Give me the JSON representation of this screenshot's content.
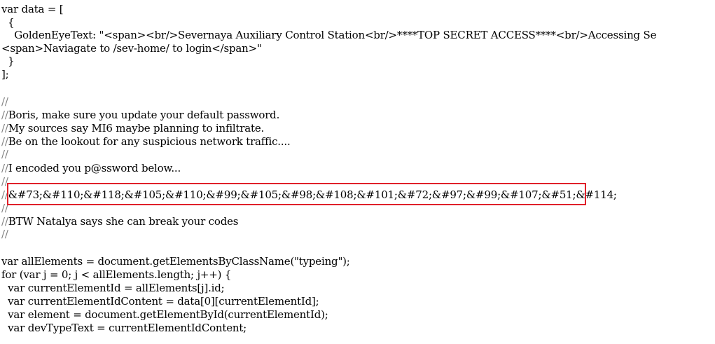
{
  "source": {
    "lines": [
      {
        "marker": "",
        "text": "var data = ["
      },
      {
        "marker": "",
        "text": "  {"
      },
      {
        "marker": "",
        "text": "    GoldenEyeText: \"<span><br/>Severnaya Auxiliary Control Station<br/>****TOP SECRET ACCESS****<br/>Accessing Se"
      },
      {
        "marker": "",
        "text": "<span>Naviagate to /sev-home/ to login</span>\""
      },
      {
        "marker": "",
        "text": "  }"
      },
      {
        "marker": "",
        "text": "];"
      },
      {
        "marker": "",
        "text": ""
      },
      {
        "marker": "//",
        "text": ""
      },
      {
        "marker": "//",
        "text": "Boris, make sure you update your default password."
      },
      {
        "marker": "//",
        "text": "My sources say MI6 maybe planning to infiltrate."
      },
      {
        "marker": "//",
        "text": "Be on the lookout for any suspicious network traffic...."
      },
      {
        "marker": "//",
        "text": ""
      },
      {
        "marker": "//",
        "text": "I encoded you p@ssword below..."
      },
      {
        "marker": "//",
        "text": ""
      },
      {
        "marker": "//",
        "text": "&#73;&#110;&#118;&#105;&#110;&#99;&#105;&#98;&#108;&#101;&#72;&#97;&#99;&#107;&#51;&#114;"
      },
      {
        "marker": "//",
        "text": ""
      },
      {
        "marker": "//",
        "text": "BTW Natalya says she can break your codes"
      },
      {
        "marker": "//",
        "text": ""
      },
      {
        "marker": "",
        "text": ""
      },
      {
        "marker": "",
        "text": "var allElements = document.getElementsByClassName(\"typeing\");"
      },
      {
        "marker": "",
        "text": "for (var j = 0; j < allElements.length; j++) {"
      },
      {
        "marker": "",
        "text": "  var currentElementId = allElements[j].id;"
      },
      {
        "marker": "",
        "text": "  var currentElementIdContent = data[0][currentElementId];"
      },
      {
        "marker": "",
        "text": "  var element = document.getElementById(currentElementId);"
      },
      {
        "marker": "",
        "text": "  var devTypeText = currentElementIdContent;"
      }
    ]
  },
  "highlight": {
    "color": "#e0202a"
  }
}
